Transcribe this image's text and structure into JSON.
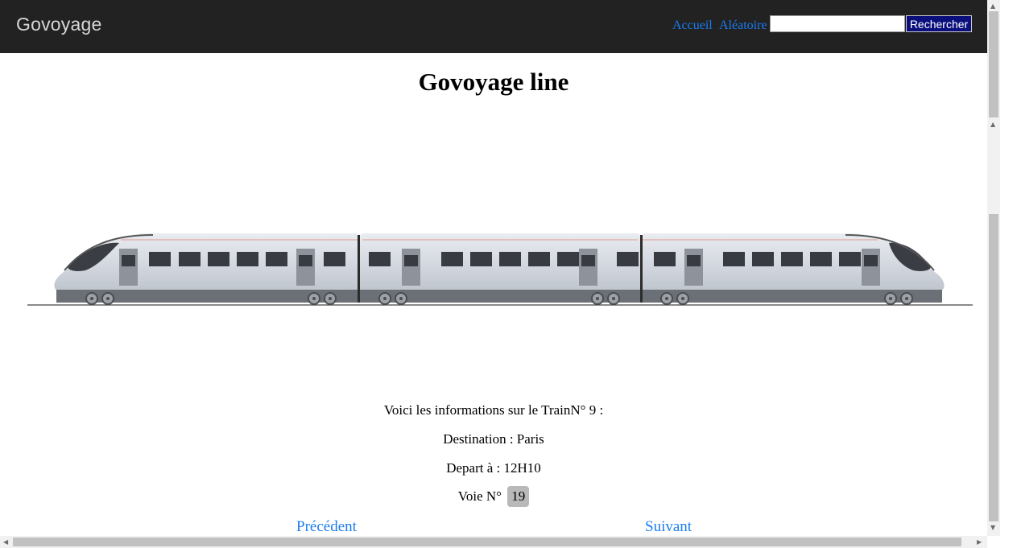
{
  "navbar": {
    "brand": "Govoyage",
    "links": [
      "Accueil",
      "Aléatoire"
    ],
    "search_placeholder": "",
    "search_button": "Rechercher"
  },
  "page": {
    "title": "Govoyage line",
    "train_image_alt": "train-illustration"
  },
  "info": {
    "intro": "Voici les informations sur le TrainN° 9 :",
    "destination": "Destination : Paris",
    "departure": "Depart à : 12H10",
    "track_label": "Voie N°",
    "track_number": "19"
  },
  "pager": {
    "previous": "Précédent",
    "next": "Suivant"
  },
  "colors": {
    "navbar_bg": "#222222",
    "link": "#1a7cf0",
    "search_button_bg": "#0a0f7c",
    "badge_bg": "#b9b9b9"
  },
  "icons": {
    "scroll_up": "triangle-up",
    "scroll_down": "triangle-down",
    "scroll_left": "triangle-left",
    "scroll_right": "triangle-right"
  }
}
